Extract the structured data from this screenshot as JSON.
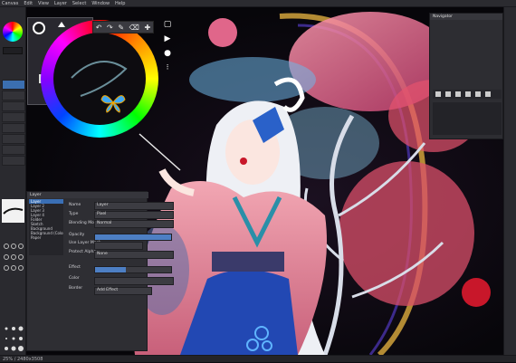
{
  "menubar": {
    "items": [
      "Canvas",
      "Edit",
      "View",
      "Layer",
      "Select",
      "Window",
      "Help"
    ]
  },
  "statusbar": {
    "text": "25% / 2480x3508"
  },
  "left_tools": [
    {
      "name": "pen"
    },
    {
      "name": "brush"
    },
    {
      "name": "eraser"
    },
    {
      "name": "fill"
    },
    {
      "name": "select"
    },
    {
      "name": "move"
    },
    {
      "name": "text"
    },
    {
      "name": "zoom"
    }
  ],
  "quick_bar": [
    "↶",
    "↷",
    "✎",
    "⌫",
    "✚"
  ],
  "layer_panel": {
    "title": "Layer",
    "layers": [
      "Layer",
      "Layer 2",
      "Layer 3",
      "Layer 4",
      "Folder",
      "Sketch",
      "Background",
      "Background (Color)",
      "Paper"
    ],
    "selected": 0,
    "name_label": "Name",
    "name_value": "Layer",
    "type_label": "Type",
    "type_value": "Pixel",
    "blend_label": "Blending Mode",
    "blend_value": "Normal",
    "opacity_label": "Opacity",
    "opacity": 1.0,
    "mask_label": "Use Layer Mask",
    "protect_label": "Protect Alpha",
    "protect_value": "None",
    "effect_label": "Effect",
    "color_label": "Color",
    "border_label": "Border",
    "border_value": "Add Effect"
  },
  "right_panel": {
    "title": "Navigator"
  },
  "colors": {
    "pink_circle": "#e0668a",
    "red_circle": "#c8172a",
    "panel_bg": "#2e2e33",
    "accent": "#3b6fb0"
  },
  "icons": [
    "palette-icon",
    "undo-icon",
    "redo-icon",
    "brush-icon",
    "eraser-icon",
    "play-icon",
    "circle-icon",
    "butterfly-icon"
  ]
}
